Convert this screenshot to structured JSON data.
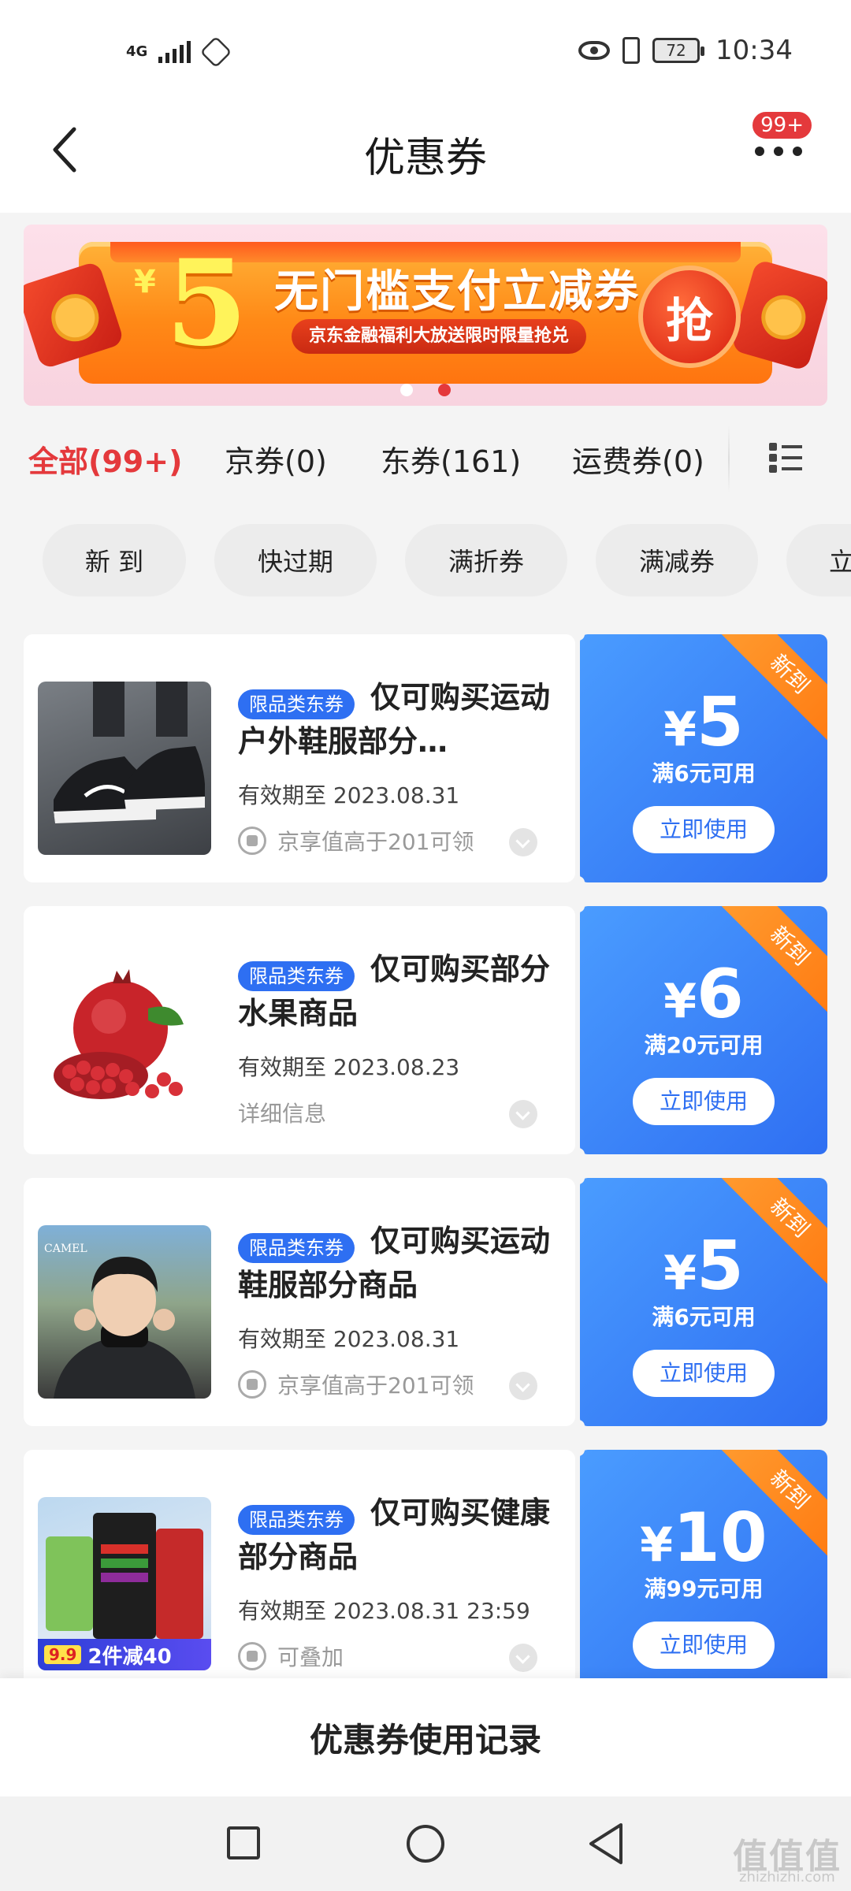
{
  "status_bar": {
    "network": "4G",
    "battery": "72",
    "time": "10:34"
  },
  "header": {
    "title": "优惠券",
    "message_badge": "99+"
  },
  "banner": {
    "currency": "¥",
    "amount": "5",
    "title": "无门槛支付立减券",
    "subtitle": "京东金融福利大放送限时限量抢兑",
    "grab_label": "抢"
  },
  "tabs": [
    {
      "label": "全部(99+)",
      "active": true
    },
    {
      "label": "京券(0)",
      "active": false
    },
    {
      "label": "东券(161)",
      "active": false
    },
    {
      "label": "运费券(0)",
      "active": false
    }
  ],
  "filters": [
    "新 到",
    "快过期",
    "满折券",
    "满减券",
    "立"
  ],
  "coupons": [
    {
      "tag": "限品类东券",
      "title": "仅可购买运动户外鞋服部分…",
      "valid": "有效期至 2023.08.31",
      "note": "京享值高于201可领",
      "currency": "¥",
      "amount": "5",
      "condition": "满6元可用",
      "ribbon": "新到",
      "button": "立即使用",
      "thumb": "sneaker-image"
    },
    {
      "tag": "限品类东券",
      "title": "仅可购买部分水果商品",
      "valid": "有效期至 2023.08.23",
      "note": "详细信息",
      "currency": "¥",
      "amount": "6",
      "condition": "满20元可用",
      "ribbon": "新到",
      "button": "立即使用",
      "thumb": "pomegranate-image"
    },
    {
      "tag": "限品类东券",
      "title": "仅可购买运动鞋服部分商品",
      "valid": "有效期至 2023.08.31",
      "note": "京享值高于201可领",
      "currency": "¥",
      "amount": "5",
      "condition": "满6元可用",
      "ribbon": "新到",
      "button": "立即使用",
      "thumb": "camel-jacket-image",
      "thumb_brand": "CAMEL"
    },
    {
      "tag": "限品类东券",
      "title": "仅可购买健康部分商品",
      "valid": "有效期至 2023.08.31 23:59",
      "note": "可叠加",
      "currency": "¥",
      "amount": "10",
      "condition": "满99元可用",
      "ribbon": "新到",
      "button": "立即使用",
      "thumb": "health-product-image",
      "thumb_promo": "2件减40",
      "thumb_price": "9.9"
    }
  ],
  "footer": {
    "history_label": "优惠券使用记录"
  },
  "watermark": {
    "main": "值值值",
    "sub": "zhizhizhi.com"
  },
  "colors": {
    "accent_red": "#e4393c",
    "coupon_blue": "#2f6ff2",
    "ribbon_orange": "#ff8a1e"
  }
}
